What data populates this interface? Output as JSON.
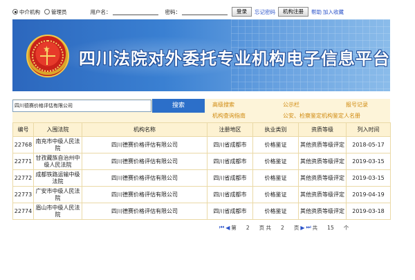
{
  "topbar": {
    "radio_agency": "中介机构",
    "radio_admin": "管理员",
    "username_label": "用户名：",
    "password_label": "密码：",
    "login_button": "登录",
    "forgot_password": "忘记密码",
    "register_button": "机构注册",
    "help": "帮助",
    "favorite": "加入收藏"
  },
  "banner": {
    "title": "四川法院对外委托专业机构电子信息平台"
  },
  "search": {
    "value": "四川德赛价格评估有限公司",
    "button": "搜索"
  },
  "quick_links": {
    "advanced_search": "高级搜索",
    "notice_board": "公示栏",
    "report_records": "报号记录",
    "org_query_guide": "机构查询指南",
    "public_security": "公安、检察鉴定机构鉴定人名册"
  },
  "table": {
    "headers": [
      "编号",
      "入围法院",
      "机构名称",
      "注册地区",
      "执业类别",
      "资质等级",
      "列入时间"
    ],
    "rows": [
      {
        "id": "22768",
        "court": "南充市中级人民法院",
        "org": "四川德赛价格评估有限公司",
        "region": "四川省成都市",
        "category": "价格鉴证",
        "grade": "其他资质等级评定",
        "date": "2018-05-17"
      },
      {
        "id": "22771",
        "court": "甘孜藏族自治州中级人民法院",
        "org": "四川德赛价格评估有限公司",
        "region": "四川省成都市",
        "category": "价格鉴证",
        "grade": "其他资质等级评定",
        "date": "2019-03-15"
      },
      {
        "id": "22772",
        "court": "成都铁路运输中级法院",
        "org": "四川德赛价格评估有限公司",
        "region": "四川省成都市",
        "category": "价格鉴证",
        "grade": "其他资质等级评定",
        "date": "2019-03-15"
      },
      {
        "id": "22773",
        "court": "广安市中级人民法院",
        "org": "四川德赛价格评估有限公司",
        "region": "四川省成都市",
        "category": "价格鉴证",
        "grade": "其他资质等级评定",
        "date": "2019-04-19"
      },
      {
        "id": "22774",
        "court": "眉山市中级人民法院",
        "org": "四川德赛价格评估有限公司",
        "region": "四川省成都市",
        "category": "价格鉴证",
        "grade": "其他资质等级评定",
        "date": "2019-03-18"
      }
    ]
  },
  "pager": {
    "page_label_1": "第",
    "current_page": "2",
    "page_label_2": "页 共",
    "total_pages": "2",
    "page_label_3": "页",
    "total_label": "共",
    "total_count": "15",
    "count_unit": "个"
  }
}
